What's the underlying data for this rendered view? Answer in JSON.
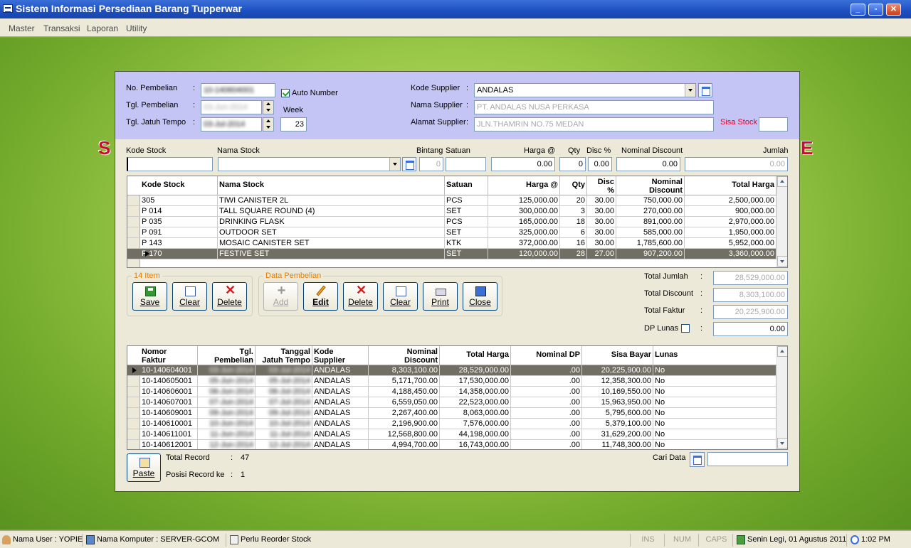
{
  "window": {
    "title": "Sistem Informasi Persediaan Barang Tupperwar"
  },
  "menu": [
    "Master",
    "Transaksi",
    "Laporan",
    "Utility"
  ],
  "header": {
    "no_pembelian_label": "No. Pembelian",
    "no_pembelian_value": "10-140604001",
    "auto_number_label": "Auto Number",
    "tgl_pembelian_label": "Tgl. Pembelian",
    "tgl_pembelian_value": "03-Jun-2014",
    "tgl_jatuh_tempo_label": "Tgl. Jatuh Tempo",
    "tgl_jatuh_tempo_value": "03-Jul-2014",
    "week_label": "Week",
    "week_value": "23",
    "kode_supplier_label": "Kode Supplier",
    "kode_supplier_value": "ANDALAS",
    "nama_supplier_label": "Nama Supplier",
    "nama_supplier_value": "PT. ANDALAS NUSA PERKASA",
    "alamat_supplier_label": "Alamat Supplier",
    "alamat_supplier_value": "JLN.THAMRIN NO.75 MEDAN",
    "sisa_stock_label": "Sisa Stock",
    "colon": ":"
  },
  "entry": {
    "labels": {
      "kode": "Kode Stock",
      "nama": "Nama Stock",
      "bintang": "Bintang",
      "satuan": "Satuan",
      "harga": "Harga @",
      "qty": "Qty",
      "disc": "Disc %",
      "nominal": "Nominal Discount",
      "jumlah": "Jumlah"
    },
    "values": {
      "kode": "",
      "nama": "",
      "bintang": "0",
      "satuan": "",
      "harga": "0.00",
      "qty": "0",
      "disc": "0.00",
      "nominal": "0.00",
      "jumlah": "0.00"
    }
  },
  "detail_grid": {
    "headers": {
      "kode": "Kode Stock",
      "nama": "Nama Stock",
      "satuan": "Satuan",
      "harga": "Harga @",
      "qty": "Qty",
      "disc1": "Disc",
      "disc2": "%",
      "nom1": "Nominal",
      "nom2": "Discount",
      "total": "Total Harga"
    },
    "rows": [
      {
        "kode": "305",
        "nama": "TIWI CANISTER 2L",
        "satuan": "PCS",
        "harga": "125,000.00",
        "qty": "20",
        "disc": "30.00",
        "nominal": "750,000.00",
        "total": "2,500,000.00"
      },
      {
        "kode": "P 014",
        "nama": "TALL SQUARE ROUND (4)",
        "satuan": "SET",
        "harga": "300,000.00",
        "qty": "3",
        "disc": "30.00",
        "nominal": "270,000.00",
        "total": "900,000.00"
      },
      {
        "kode": "P 035",
        "nama": "DRINKING FLASK",
        "satuan": "PCS",
        "harga": "165,000.00",
        "qty": "18",
        "disc": "30.00",
        "nominal": "891,000.00",
        "total": "2,970,000.00"
      },
      {
        "kode": "P 091",
        "nama": "OUTDOOR SET",
        "satuan": "SET",
        "harga": "325,000.00",
        "qty": "6",
        "disc": "30.00",
        "nominal": "585,000.00",
        "total": "1,950,000.00"
      },
      {
        "kode": "P 143",
        "nama": "MOSAIC CANISTER SET",
        "satuan": "KTK",
        "harga": "372,000.00",
        "qty": "16",
        "disc": "30.00",
        "nominal": "1,785,600.00",
        "total": "5,952,000.00"
      },
      {
        "kode": "P 170",
        "nama": "FESTIVE SET",
        "satuan": "SET",
        "harga": "120,000.00",
        "qty": "28",
        "disc": "27.00",
        "nominal": "907,200.00",
        "total": "3,360,000.00"
      }
    ]
  },
  "group1": {
    "title": "14 Item",
    "save": "Save",
    "clear": "Clear",
    "delete": "Delete"
  },
  "group2": {
    "title": "Data Pembelian",
    "add": "Add",
    "edit": "Edit",
    "delete": "Delete",
    "clear": "Clear",
    "print": "Print",
    "close": "Close"
  },
  "totals": {
    "jumlah_label": "Total Jumlah",
    "jumlah_value": "28,529,000.00",
    "discount_label": "Total Discount",
    "discount_value": "8,303,100.00",
    "faktur_label": "Total Faktur",
    "faktur_value": "20,225,900.00",
    "dp_label": "DP Lunas",
    "dp_value": "0.00"
  },
  "invoice_grid": {
    "headers": {
      "nomor1": "Nomor",
      "nomor2": "Faktur",
      "tgl1": "Tgl.",
      "tgl2": "Pembelian",
      "tj1": "Tanggal",
      "tj2": "Jatuh Tempo",
      "ks1": "Kode",
      "ks2": "Supplier",
      "nd1": "Nominal",
      "nd2": "Discount",
      "total": "Total Harga",
      "dp": "Nominal DP",
      "sisa": "Sisa Bayar",
      "lunas": "Lunas"
    },
    "rows": [
      {
        "nomor": "10-140604001",
        "tgl": "03-Jun-2014",
        "tj": "03-Jul-2014",
        "sup": "ANDALAS",
        "nd": "8,303,100.00",
        "total": "28,529,000.00",
        "dp": ".00",
        "sisa": "20,225,900.00",
        "lunas": "No"
      },
      {
        "nomor": "10-140605001",
        "tgl": "05-Jun-2014",
        "tj": "05-Jul-2014",
        "sup": "ANDALAS",
        "nd": "5,171,700.00",
        "total": "17,530,000.00",
        "dp": ".00",
        "sisa": "12,358,300.00",
        "lunas": "No"
      },
      {
        "nomor": "10-140606001",
        "tgl": "06-Jun-2014",
        "tj": "06-Jul-2014",
        "sup": "ANDALAS",
        "nd": "4,188,450.00",
        "total": "14,358,000.00",
        "dp": ".00",
        "sisa": "10,169,550.00",
        "lunas": "No"
      },
      {
        "nomor": "10-140607001",
        "tgl": "07-Jun-2014",
        "tj": "07-Jul-2014",
        "sup": "ANDALAS",
        "nd": "6,559,050.00",
        "total": "22,523,000.00",
        "dp": ".00",
        "sisa": "15,963,950.00",
        "lunas": "No"
      },
      {
        "nomor": "10-140609001",
        "tgl": "09-Jun-2014",
        "tj": "09-Jul-2014",
        "sup": "ANDALAS",
        "nd": "2,267,400.00",
        "total": "8,063,000.00",
        "dp": ".00",
        "sisa": "5,795,600.00",
        "lunas": "No"
      },
      {
        "nomor": "10-140610001",
        "tgl": "10-Jun-2014",
        "tj": "10-Jul-2014",
        "sup": "ANDALAS",
        "nd": "2,196,900.00",
        "total": "7,576,000.00",
        "dp": ".00",
        "sisa": "5,379,100.00",
        "lunas": "No"
      },
      {
        "nomor": "10-140611001",
        "tgl": "11-Jun-2014",
        "tj": "11-Jul-2014",
        "sup": "ANDALAS",
        "nd": "12,568,800.00",
        "total": "44,198,000.00",
        "dp": ".00",
        "sisa": "31,629,200.00",
        "lunas": "No"
      },
      {
        "nomor": "10-140612001",
        "tgl": "12-Jun-2014",
        "tj": "12-Jul-2014",
        "sup": "ANDALAS",
        "nd": "4,994,700.00",
        "total": "16,743,000.00",
        "dp": ".00",
        "sisa": "11,748,300.00",
        "lunas": "No"
      }
    ]
  },
  "footer": {
    "paste": "Paste",
    "total_record_label": "Total Record",
    "total_record_value": "47",
    "posisi_label": "Posisi Record  ke",
    "posisi_value": "1",
    "cari_label": "Cari Data"
  },
  "statusbar": {
    "user": "Nama User : YOPIE",
    "komputer": "Nama Komputer : SERVER-GCOM",
    "reorder": "Perlu Reorder Stock",
    "ins": "INS",
    "num": "NUM",
    "caps": "CAPS",
    "date": "Senin Legi, 01 Agustus 2011",
    "time": "1:02 PM"
  },
  "colors": {
    "header_bg": "#c5c5f5",
    "selected_row": "#716f64",
    "group_title": "#e87c00",
    "sisa_stock": "#e0002a"
  }
}
